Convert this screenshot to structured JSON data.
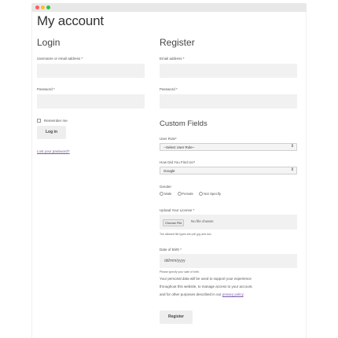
{
  "window": {
    "controls": [
      "close",
      "minimize",
      "maximize"
    ]
  },
  "page": {
    "title": "My account"
  },
  "login": {
    "heading": "Login",
    "username_label": "Username or email address *",
    "password_label": "Password *",
    "remember_label": "Remember me",
    "remember_checked": false,
    "login_button": "Log in",
    "lost_password_link": "Lost your password?"
  },
  "register": {
    "heading": "Register",
    "email_label": "Email address *",
    "password_label": "Password *",
    "custom_heading": "Custom Fields",
    "role_label": "User Role*",
    "role_value": "--Select User Role--",
    "find_label": "How Did You Find Us?",
    "find_value": "Google",
    "gender_label": "Gender",
    "gender_options": [
      "Male",
      "Female",
      "Not Specify"
    ],
    "license_label": "Upload Your License *",
    "choose_file_button": "Choose File",
    "no_file_text": "No file chosen",
    "file_help": "The allowed file types are pdf, jpg and doc.",
    "dob_label": "Date of Birth *",
    "dob_placeholder": "dd/mm/yyyy",
    "dob_help": "Please specify your date of birth.",
    "privacy_text_line1": "Your personal data will be used to support your experience",
    "privacy_text_line2": "throughout this website, to manage access to your account,",
    "privacy_text_line3": "and for other purposes described in our",
    "privacy_link": "privacy policy",
    "register_button": "Register"
  },
  "colors": {
    "link": "#7a5aa6",
    "field_bg": "#f1f1f1",
    "button_bg": "#eeeeee"
  }
}
